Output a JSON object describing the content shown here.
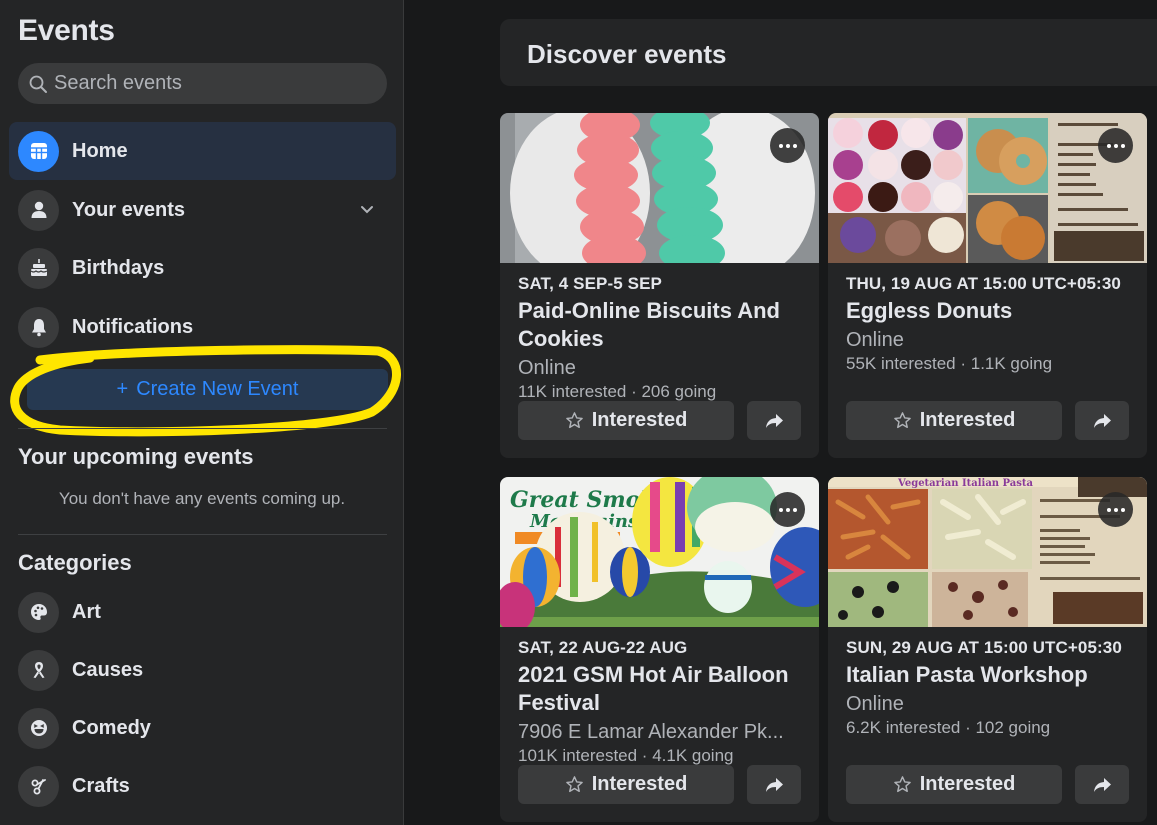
{
  "sidebar": {
    "title": "Events",
    "search": {
      "placeholder": "Search events",
      "value": ""
    },
    "nav": [
      {
        "label": "Home",
        "icon": "calendar-grid-icon",
        "active": true
      },
      {
        "label": "Your events",
        "icon": "person-icon",
        "has_dropdown": true
      },
      {
        "label": "Birthdays",
        "icon": "cake-icon"
      },
      {
        "label": "Notifications",
        "icon": "bell-icon"
      }
    ],
    "create_button": {
      "icon": "+",
      "label": "Create New Event"
    },
    "upcoming": {
      "title": "Your upcoming events",
      "empty_text": "You don't have any events coming up."
    },
    "categories": {
      "title": "Categories",
      "items": [
        {
          "label": "Art",
          "icon": "palette-icon"
        },
        {
          "label": "Causes",
          "icon": "ribbon-icon"
        },
        {
          "label": "Comedy",
          "icon": "laughing-face-icon"
        },
        {
          "label": "Crafts",
          "icon": "scissors-icon"
        }
      ]
    }
  },
  "main": {
    "title": "Discover events",
    "events": [
      {
        "date": "SAT, 4 SEP-5 SEP",
        "title": "Paid-Online Biscuits And Cookies",
        "location": "Online",
        "stats": "11K interested · 206 going",
        "interested_label": "Interested",
        "image": "pink and green biscuits on doily"
      },
      {
        "date": "THU, 19 AUG AT 15:00 UTC+05:30",
        "title": "Eggless Donuts",
        "location": "Online",
        "stats": "55K interested · 1.1K going",
        "interested_label": "Interested",
        "image": "donut collage with demo details"
      },
      {
        "date": "SAT, 22 AUG-22 AUG",
        "title": "2021 GSM Hot Air Balloon Festival",
        "location": "7906 E Lamar Alexander Pk...",
        "stats": "101K interested · 4.1K going",
        "interested_label": "Interested",
        "image": "Great Smoky Mountains hot air balloon festival"
      },
      {
        "date": "SUN, 29 AUG AT 15:00 UTC+05:30",
        "title": "Italian Pasta Workshop",
        "location": "Online",
        "stats": "6.2K interested · 102 going",
        "interested_label": "Interested",
        "image": "Vegetarian Italian Pasta workshop flyer"
      }
    ]
  },
  "colors": {
    "accent": "#2d88ff",
    "annotation": "#ffe600",
    "background": "#18191a",
    "surface": "#242526"
  }
}
